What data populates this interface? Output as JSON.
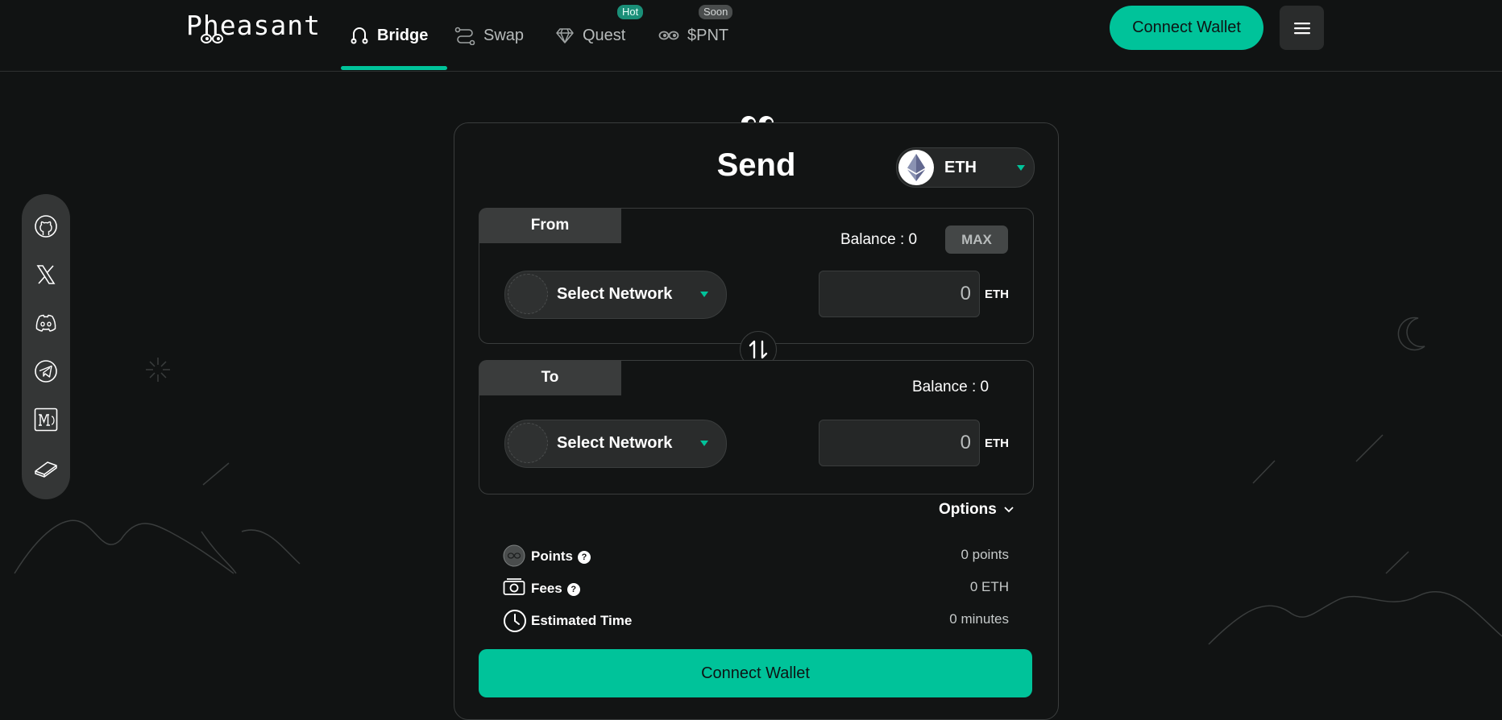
{
  "header": {
    "logo": "Pheasant",
    "nav": [
      {
        "label": "Bridge",
        "icon": "bridge-icon"
      },
      {
        "label": "Swap",
        "icon": "swap-icon"
      },
      {
        "label": "Quest",
        "icon": "diamond-icon",
        "badge": "Hot"
      },
      {
        "label": "$PNT",
        "icon": "eyes-icon",
        "badge": "Soon"
      }
    ],
    "connect_wallet": "Connect Wallet",
    "menu_icon": "hamburger-menu-icon"
  },
  "social": [
    "github-icon",
    "x-icon",
    "discord-icon",
    "telegram-icon",
    "medium-icon",
    "docs-book-icon"
  ],
  "card": {
    "title": "Send",
    "token": {
      "symbol": "ETH",
      "icon": "ethereum-icon"
    },
    "from": {
      "label": "From",
      "balance": "Balance : 0",
      "max": "MAX",
      "network_placeholder": "Select Network",
      "amount": "0",
      "unit": "ETH"
    },
    "to": {
      "label": "To",
      "balance": "Balance : 0",
      "network_placeholder": "Select Network",
      "amount": "0",
      "unit": "ETH"
    },
    "options": "Options",
    "info": [
      {
        "label": "Points",
        "value": "0 points",
        "help": "?"
      },
      {
        "label": "Fees",
        "value": "0 ETH",
        "help": "?"
      },
      {
        "label": "Estimated Time",
        "value": "0 minutes"
      }
    ],
    "connect_wallet": "Connect Wallet"
  },
  "colors": {
    "accent": "#00c39a",
    "background": "#111313",
    "panel_tab": "#3a3c3c"
  }
}
